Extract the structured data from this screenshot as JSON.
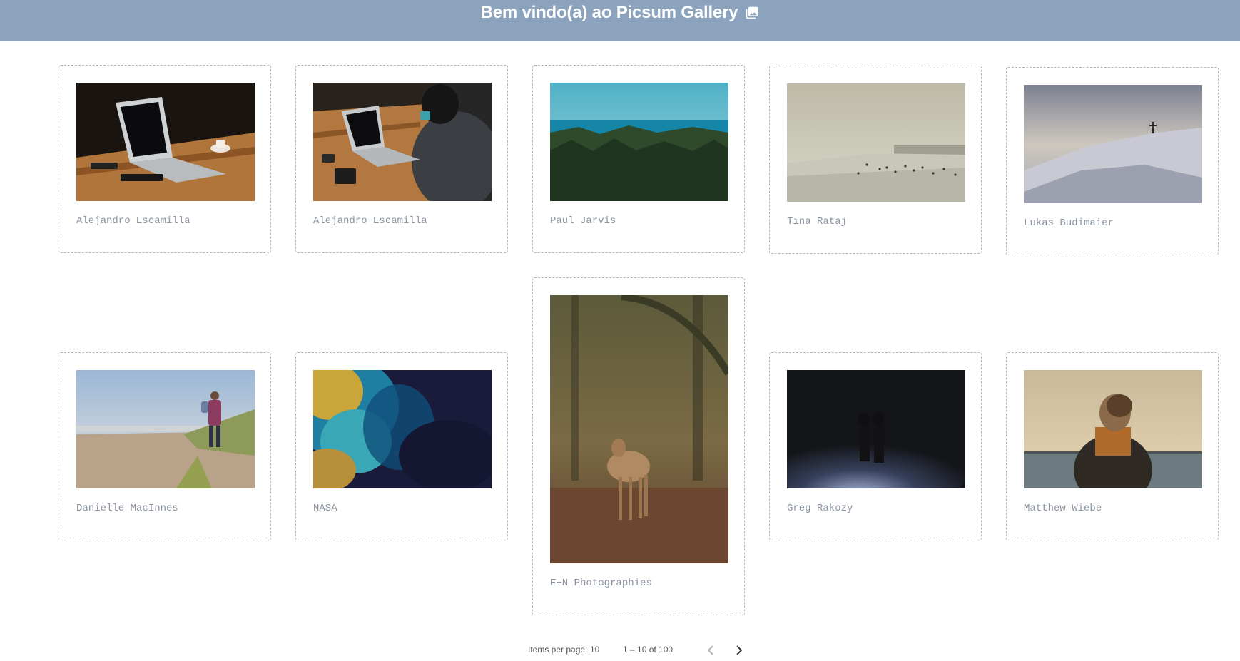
{
  "header": {
    "title": "Bem vindo(a) ao Picsum Gallery",
    "icon": "photo-library-icon",
    "background": "#8ca3bd"
  },
  "gallery": {
    "cards": [
      {
        "author": "Alejandro Escamilla",
        "image": "laptop-on-wooden-desk"
      },
      {
        "author": "Alejandro Escamilla",
        "image": "person-typing-on-laptop"
      },
      {
        "author": "Paul Jarvis",
        "image": "forest-and-sea"
      },
      {
        "author": "Tina Rataj",
        "image": "beach-with-people"
      },
      {
        "author": "Lukas Budimaier",
        "image": "snowy-mountain-summit"
      },
      {
        "author": "Danielle MacInnes",
        "image": "father-and-child-on-beach"
      },
      {
        "author": "NASA",
        "image": "satellite-ocean-view"
      },
      {
        "author": "E+N Photographies",
        "image": "fawn-in-forest"
      },
      {
        "author": "Greg Rakozy",
        "image": "couple-in-dark-spotlight"
      },
      {
        "author": "Matthew Wiebe",
        "image": "person-with-scarf-at-sea"
      }
    ]
  },
  "paginator": {
    "items_per_page_label": "Items per page:",
    "items_per_page_value": "10",
    "range_label": "1 – 10 of 100",
    "prev_icon": "chevron-left-icon",
    "next_icon": "chevron-right-icon"
  }
}
